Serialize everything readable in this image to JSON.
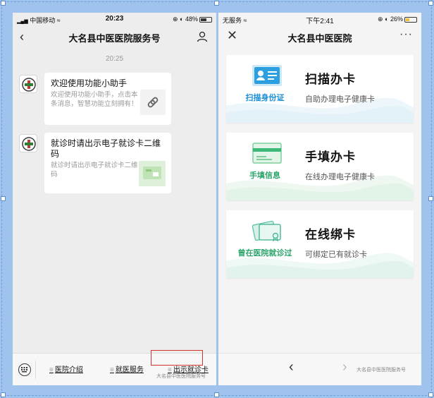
{
  "left": {
    "status": {
      "carrier": "中国移动",
      "time": "20:23",
      "battery": "48%"
    },
    "header": {
      "title": "大名县中医医院服务号"
    },
    "time_label": "20:25",
    "messages": [
      {
        "title": "欢迎使用功能小助手",
        "desc": "欢迎使用功能小助手，点击本条消息，智慧功能立刻拥有！"
      },
      {
        "title": "就诊时请出示电子就诊卡二维码",
        "desc": "就诊时请出示电子就诊卡二维码"
      }
    ],
    "menu": {
      "items": [
        {
          "label": "医院介绍"
        },
        {
          "label": "就医服务"
        },
        {
          "label": "出示就诊卡"
        }
      ]
    },
    "watermark": "大名县中医医院服务号"
  },
  "right": {
    "status": {
      "carrier": "无服务",
      "time": "下午2:41",
      "battery": "26%"
    },
    "header": {
      "title": "大名县中医医院"
    },
    "options": [
      {
        "icon": "id-card-scan-icon",
        "icon_label": "扫描身份证",
        "title": "扫描办卡",
        "subtitle": "自助办理电子健康卡"
      },
      {
        "icon": "manual-form-icon",
        "icon_label": "手填信息",
        "title": "手填办卡",
        "subtitle": "在线办理电子健康卡"
      },
      {
        "icon": "bind-card-icon",
        "icon_label": "曾在医院就诊过",
        "title": "在线绑卡",
        "subtitle": "可绑定已有就诊卡"
      }
    ],
    "watermark": "大名县中医医院服务号"
  },
  "colors": {
    "accent_blue": "#1a8fd6",
    "accent_green": "#2aa46a",
    "highlight_red": "#d2332d"
  }
}
